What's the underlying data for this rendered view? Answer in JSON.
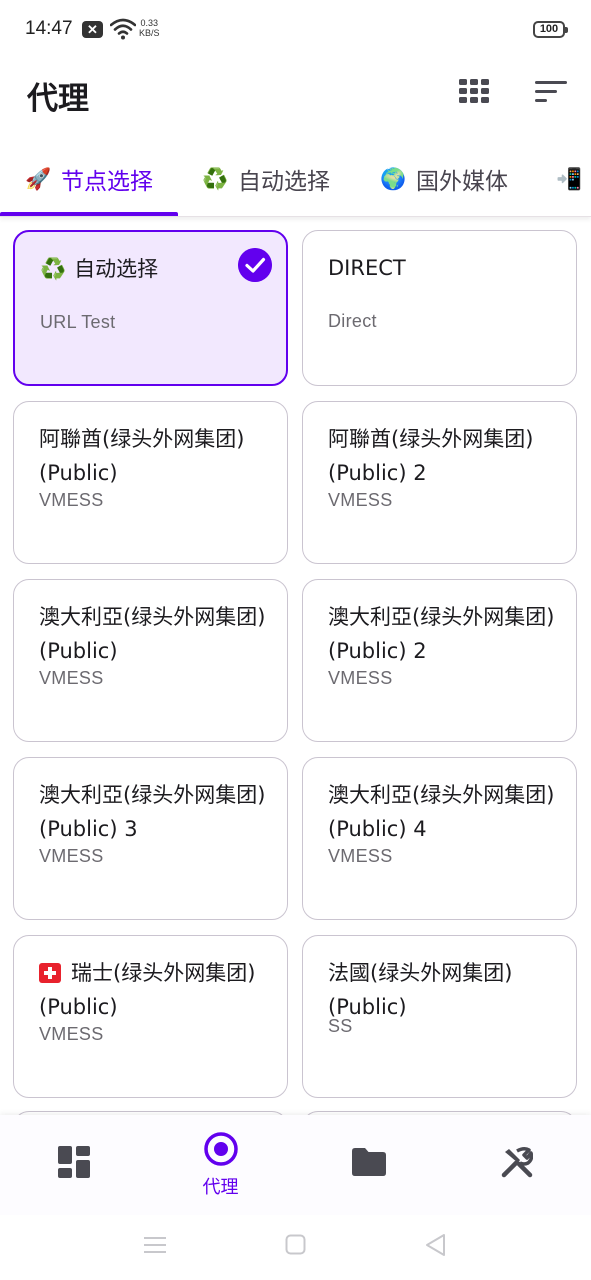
{
  "status_bar": {
    "time": "14:47",
    "notification_icon": "close-box-icon",
    "net_speed_value": "0.33",
    "net_speed_unit": "KB/S",
    "battery": "100"
  },
  "app_bar": {
    "title": "代理",
    "grid_icon": "grid-view-icon",
    "sort_icon": "sort-icon"
  },
  "tabs": [
    {
      "icon": "🚀",
      "label": "节点选择",
      "active": true
    },
    {
      "icon": "♻️",
      "label": "自动选择",
      "active": false
    },
    {
      "icon": "🌍",
      "label": "国外媒体",
      "active": false
    },
    {
      "icon": "📲",
      "label": "",
      "active": false
    }
  ],
  "cards": [
    {
      "icon": "♻️",
      "name": "自动选择",
      "type": "URL Test",
      "selected": true
    },
    {
      "icon": "",
      "name": "DIRECT",
      "type": "Direct",
      "selected": false
    },
    {
      "icon": "",
      "name": "阿聯酋(绿头外网集团)(Public)",
      "type": "VMESS",
      "selected": false
    },
    {
      "icon": "",
      "name": "阿聯酋(绿头外网集团)(Public) 2",
      "type": "VMESS",
      "selected": false
    },
    {
      "icon": "",
      "name": "澳大利亞(绿头外网集团)(Public)",
      "type": "VMESS",
      "selected": false
    },
    {
      "icon": "",
      "name": "澳大利亞(绿头外网集团)(Public) 2",
      "type": "VMESS",
      "selected": false
    },
    {
      "icon": "",
      "name": "澳大利亞(绿头外网集团)(Public) 3",
      "type": "VMESS",
      "selected": false
    },
    {
      "icon": "",
      "name": "澳大利亞(绿头外网集团)(Public) 4",
      "type": "VMESS",
      "selected": false
    },
    {
      "icon": "flag-ch",
      "name": "瑞士(绿头外网集团)(Public)",
      "type": "VMESS",
      "selected": false
    },
    {
      "icon": "",
      "name": "法國(绿头外网集团)(Public)",
      "type": "SS",
      "selected": false
    }
  ],
  "bottom_nav": [
    {
      "icon": "dashboard-icon",
      "label": "",
      "active": false
    },
    {
      "icon": "proxy-radio-icon",
      "label": "代理",
      "active": true
    },
    {
      "icon": "folder-icon",
      "label": "",
      "active": false
    },
    {
      "icon": "tools-icon",
      "label": "",
      "active": false
    }
  ],
  "colors": {
    "accent": "#6200ee",
    "selected_card_bg": "#f2e8fe",
    "card_border": "#cac4d0",
    "secondary_text": "#6c6a70"
  }
}
